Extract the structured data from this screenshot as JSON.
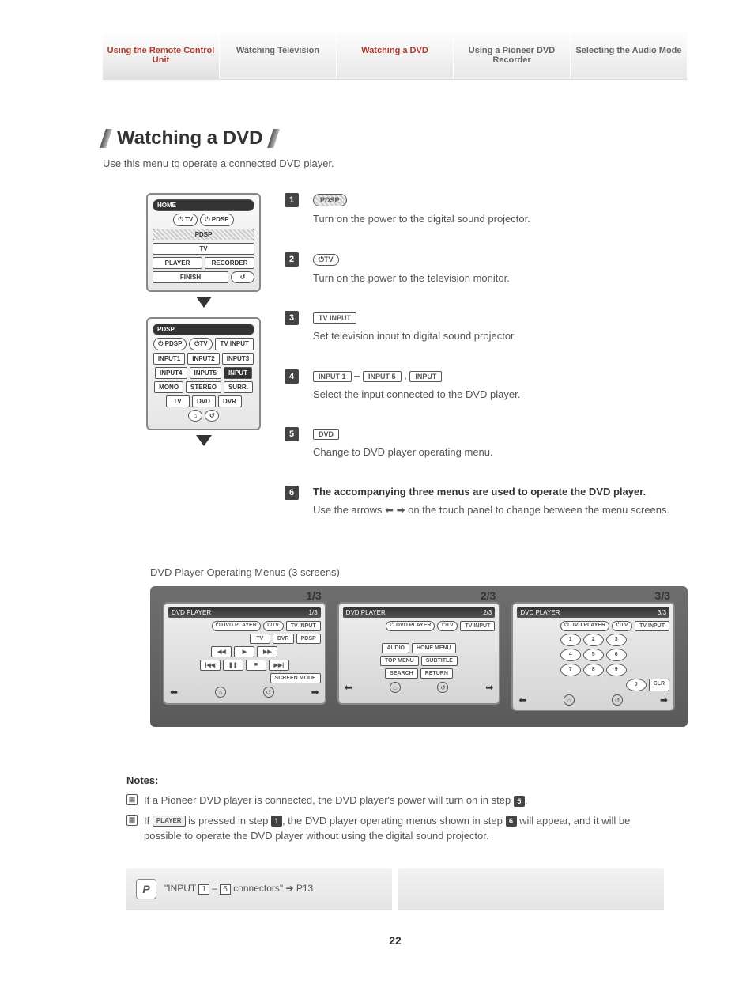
{
  "tabs": {
    "t0": "Using the Remote Control Unit",
    "t1": "Watching Television",
    "t2": "Watching a DVD",
    "t3": "Using a Pioneer DVD Recorder",
    "t4": "Selecting the Audio Mode"
  },
  "page": {
    "title": "Watching a DVD",
    "intro": "Use this menu to operate a connected DVD player.",
    "number": "22"
  },
  "remote1": {
    "home": "HOME",
    "tv_pwr": "⏻ TV",
    "pdsp_pwr": "⏻ PDSP",
    "pdsp_bar": "PDSP",
    "tv_item": "TV",
    "player": "PLAYER",
    "recorder": "RECORDER",
    "finish": "FINISH",
    "back": "↺"
  },
  "remote2": {
    "pdsp": "PDSP",
    "pdsp_pwr": "⏻ PDSP",
    "tv_pwr": "⏻TV",
    "tv_input": "TV INPUT",
    "in1": "INPUT1",
    "in2": "INPUT2",
    "in3": "INPUT3",
    "in4": "INPUT4",
    "in5": "INPUT5",
    "input": "INPUT",
    "mono": "MONO",
    "stereo": "STEREO",
    "surr": "SURR.",
    "tv": "TV",
    "dvd": "DVD",
    "dvr": "DVR"
  },
  "steps": {
    "s1": {
      "num": "1",
      "pill": "PDSP",
      "desc": "Turn on the power to the digital sound projector."
    },
    "s2": {
      "num": "2",
      "pill": "⏻TV",
      "desc": "Turn on the power to the television monitor."
    },
    "s3": {
      "num": "3",
      "pill": "TV INPUT",
      "desc": "Set television input to digital sound projector."
    },
    "s4": {
      "num": "4",
      "pill_a": "INPUT 1",
      "dash": "–",
      "pill_b": "INPUT 5",
      "sep": ",",
      "pill_c": "INPUT",
      "desc": "Select the input connected to the DVD player."
    },
    "s5": {
      "num": "5",
      "pill": "DVD",
      "desc": "Change to DVD player operating menu."
    },
    "s6": {
      "num": "6",
      "title": "The accompanying three menus are used to operate the DVD player.",
      "desc_a": "Use the arrows ",
      "desc_b": " on the touch panel to change between the menu screens."
    }
  },
  "screens_title": "DVD Player Operating Menus (3 screens)",
  "screens": {
    "s1": {
      "frac": "1/3",
      "header": "DVD PLAYER",
      "hpage": "1/3",
      "player": "⏻ DVD PLAYER",
      "tv": "⏻TV",
      "tvin": "TV INPUT",
      "btn_tv": "TV",
      "btn_dvr": "DVR",
      "btn_pdsp": "PDSP",
      "r2a": "◀◀",
      "r2b": "▶",
      "r2c": "▶▶",
      "r3a": "|◀◀",
      "r3b": "❚❚",
      "r3c": "■",
      "r3d": "▶▶|",
      "screenmode": "SCREEN MODE"
    },
    "s2": {
      "frac": "2/3",
      "header": "DVD PLAYER",
      "hpage": "2/3",
      "player": "⏻ DVD PLAYER",
      "tv": "⏻TV",
      "tvin": "TV INPUT",
      "audio": "AUDIO",
      "homemenu": "HOME MENU",
      "topmenu": "TOP MENU",
      "subtitle": "SUBTITLE",
      "search": "SEARCH",
      "return": "RETURN"
    },
    "s3": {
      "frac": "3/3",
      "header": "DVD PLAYER",
      "hpage": "3/3",
      "player": "⏻ DVD PLAYER",
      "tv": "⏻TV",
      "tvin": "TV INPUT",
      "n1": "1",
      "n2": "2",
      "n3": "3",
      "n4": "4",
      "n5": "5",
      "n6": "6",
      "n7": "7",
      "n8": "8",
      "n9": "9",
      "n0": "0",
      "clr": "CLR"
    }
  },
  "notes": {
    "heading": "Notes:",
    "n1_a": "If a Pioneer DVD player is connected, the DVD player's power will turn on in step ",
    "n1_b": ".",
    "n1_step": "5",
    "n2_a": "If ",
    "n2_pill": "PLAYER",
    "n2_b": " is pressed in step ",
    "n2_step1": "1",
    "n2_c": ", the DVD player operating menus shown in step ",
    "n2_step2": "6",
    "n2_d": " will appear, and it will be possible to operate the DVD player without using the digital sound projector."
  },
  "footer": {
    "icon": "P",
    "text_a": "\"INPUT ",
    "box1": "1",
    "text_b": " – ",
    "box2": "5",
    "text_c": " connectors\" ➔ P13"
  }
}
